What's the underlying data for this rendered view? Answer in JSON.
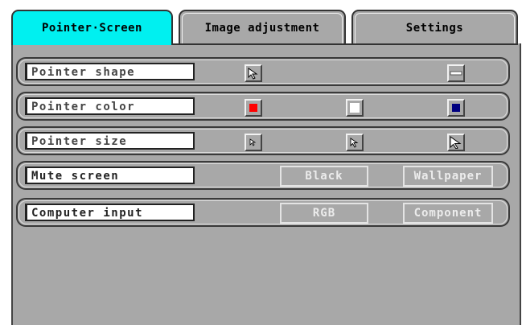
{
  "tabs": [
    {
      "label": "Pointer·Screen",
      "active": true
    },
    {
      "label": "Image adjustment",
      "active": false
    },
    {
      "label": "Settings",
      "active": false
    }
  ],
  "rows": {
    "pointer_shape": {
      "label": "Pointer shape",
      "options": [
        "arrow-pointer-icon",
        "bar-pointer-icon"
      ]
    },
    "pointer_color": {
      "label": "Pointer color",
      "options": [
        {
          "name": "red",
          "hex": "#ff0000"
        },
        {
          "name": "white",
          "hex": "#ffffff"
        },
        {
          "name": "blue",
          "hex": "#000080"
        }
      ]
    },
    "pointer_size": {
      "label": "Pointer size",
      "options": [
        "small-pointer-icon",
        "medium-pointer-icon",
        "large-pointer-icon"
      ]
    },
    "mute_screen": {
      "label": "Mute screen",
      "options": [
        "Black",
        "Wallpaper"
      ]
    },
    "computer_input": {
      "label": "Computer input",
      "options": [
        "RGB",
        "Component"
      ]
    }
  },
  "colors": {
    "active_tab": "#00f0f0",
    "panel": "#a8a8a8"
  }
}
